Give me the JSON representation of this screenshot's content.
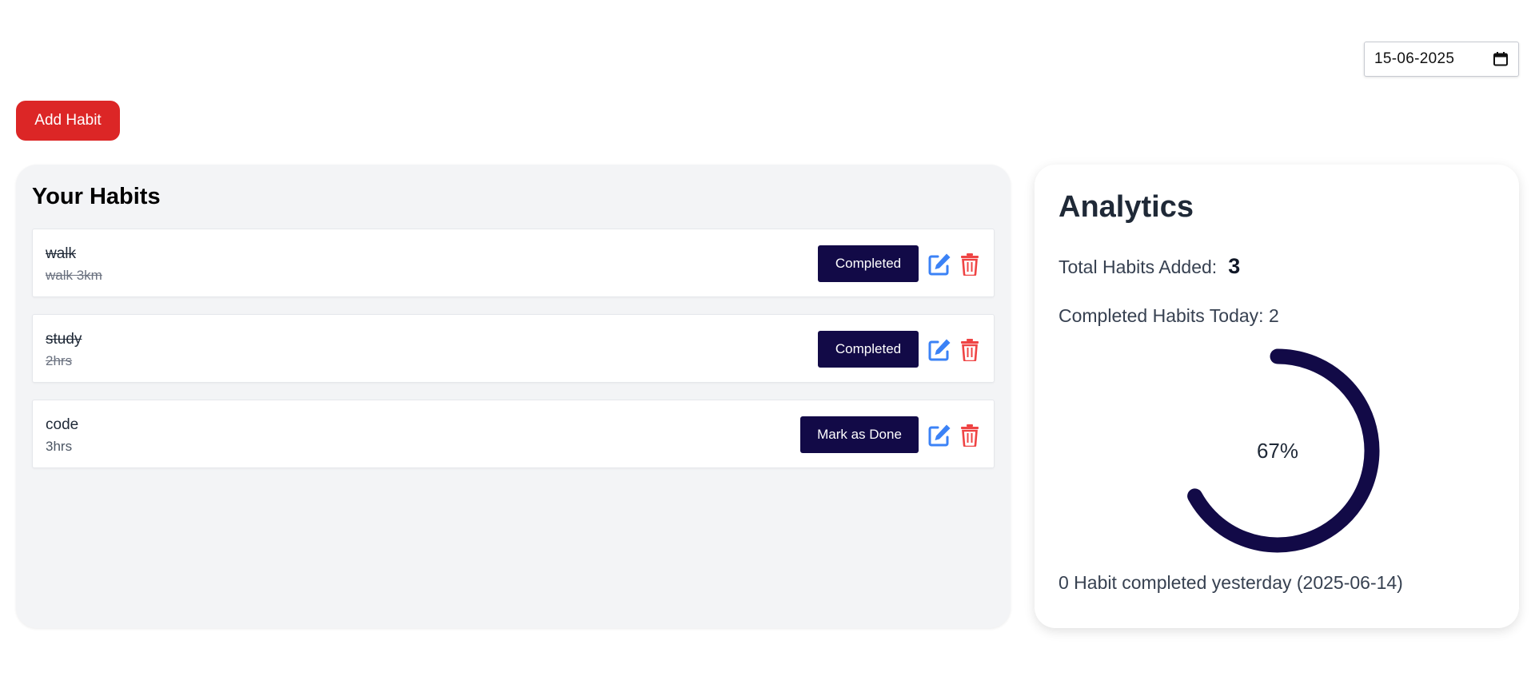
{
  "date_picker": {
    "value": "15-06-2025",
    "icon": "calendar-icon"
  },
  "toolbar": {
    "add_habit_label": "Add Habit",
    "add_habit_color": "#dc2626"
  },
  "habits_panel": {
    "title": "Your Habits",
    "items": [
      {
        "name": "walk",
        "description": "walk 3km",
        "completed": true,
        "action_label": "Completed"
      },
      {
        "name": "study",
        "description": "2hrs",
        "completed": true,
        "action_label": "Completed"
      },
      {
        "name": "code",
        "description": "3hrs",
        "completed": false,
        "action_label": "Mark as Done"
      }
    ],
    "icons": {
      "edit": "edit-icon",
      "delete": "trash-icon"
    },
    "colors": {
      "action_button": "#120a47",
      "edit_icon": "#3b82f6",
      "delete_icon": "#ef4444"
    }
  },
  "analytics": {
    "title": "Analytics",
    "total_label": "Total Habits Added:",
    "total_value": "3",
    "completed_today_label": "Completed Habits Today: 2",
    "progress_percent": 67,
    "progress_label": "67%",
    "progress_color": "#120a47",
    "yesterday_text": "0 Habit completed yesterday (2025-06-14)"
  }
}
